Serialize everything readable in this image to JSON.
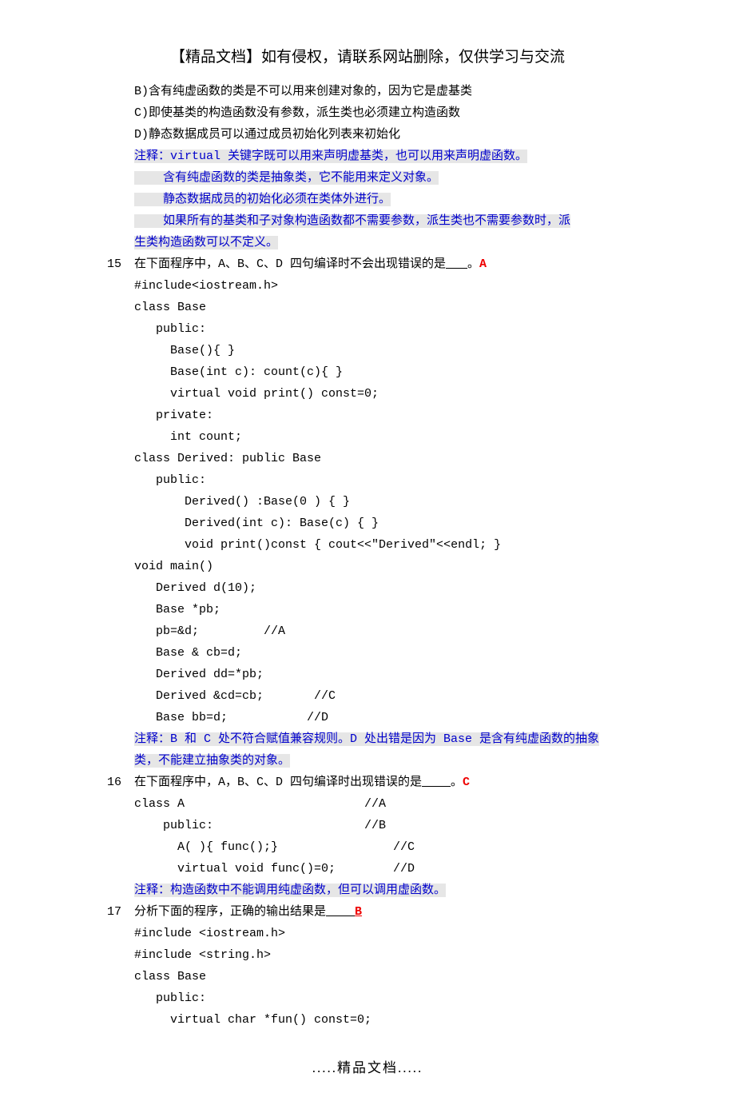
{
  "title": "【精品文档】如有侵权，请联系网站删除，仅供学习与交流",
  "block1": {
    "optB": "B)含有纯虚函数的类是不可以用来创建对象的，因为它是虚基类",
    "optC": "C)即使基类的构造函数没有参数，派生类也必须建立构造函数",
    "optD": "D)静态数据成员可以通过成员初始化列表来初始化",
    "note1": "注释：virtual 关键字既可以用来声明虚基类，也可以用来声明虚函数。",
    "note2": "    含有纯虚函数的类是抽象类，它不能用来定义对象。",
    "note3": "    静态数据成员的初始化必须在类体外进行。",
    "note4a": "    如果所有的基类和子对象构造函数都不需要参数，派生类也不需要参数时，派",
    "note4b": "生类构造函数可以不定义。"
  },
  "q15": {
    "num": "15",
    "stemA": "在下面程序中，A、B、C、D 四句编译时不会出现错误的是",
    "stemB": "。",
    "ans": "A",
    "c1": "#include<iostream.h>",
    "c2": "class Base",
    "c3": "   public:",
    "c4": "     Base(){ }",
    "c5": "     Base(int c): count(c){ }",
    "c6": "     virtual void print() const=0;",
    "c7": "   private:",
    "c8": "     int count;",
    "c9": "class Derived: public Base",
    "c10": "   public:",
    "c11": "       Derived() :Base(0 ) { }",
    "c12": "       Derived(int c): Base(c) { }",
    "c13": "       void print()const { cout<<\"Derived\"<<endl; }",
    "c14": "void main()",
    "c15": "   Derived d(10);",
    "c16": "   Base *pb;",
    "c17": "   pb=&d;         //A",
    "c18": "   Base & cb=d;",
    "c19": "   Derived dd=*pb;",
    "c20": "   Derived &cd=cb;       //C",
    "c21": "   Base bb=d;           //D",
    "noteA": "注释：B 和 C 处不符合赋值兼容规则。D 处出错是因为 Base 是含有纯虚函数的抽象",
    "noteB": "类，不能建立抽象类的对象。"
  },
  "q16": {
    "num": "16",
    "stemA": "在下面程序中，A，B、C、D 四句编译时出现错误的是",
    "stemB": "。",
    "ans": "C",
    "c1": "class A                         //A",
    "c2": "    public:                     //B",
    "c3": "      A( ){ func();}                //C",
    "c4": "      virtual void func()=0;        //D",
    "note": "注释：构造函数中不能调用纯虚函数，但可以调用虚函数。"
  },
  "q17": {
    "num": "17",
    "stemA": "分析下面的程序，正确的输出结果是",
    "ans": "B",
    "c1": "#include <iostream.h>",
    "c2": "#include <string.h>",
    "c3": "class Base",
    "c4": "   public:",
    "c5": "     virtual char *fun() const=0;"
  },
  "footer": ".....精品文档....."
}
